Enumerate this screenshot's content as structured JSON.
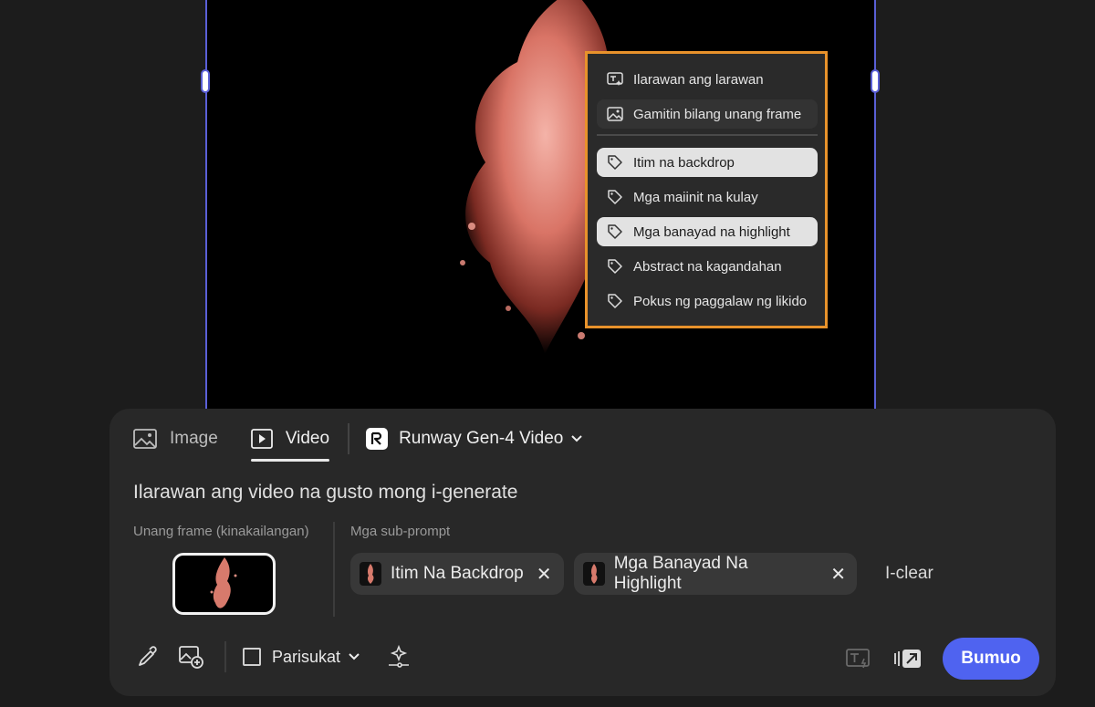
{
  "context_menu": {
    "actions": [
      {
        "label": "Ilarawan ang larawan",
        "icon": "describe-image-icon"
      },
      {
        "label": "Gamitin bilang unang frame",
        "icon": "image-icon"
      }
    ],
    "tags": [
      {
        "label": "Itim na backdrop",
        "icon": "tag-icon"
      },
      {
        "label": "Mga maiinit na kulay",
        "icon": "tag-icon"
      },
      {
        "label": "Mga banayad na highlight",
        "icon": "tag-icon"
      },
      {
        "label": "Abstract na kagandahan",
        "icon": "tag-icon"
      },
      {
        "label": "Pokus ng paggalaw ng likido",
        "icon": "tag-icon"
      }
    ]
  },
  "panel": {
    "tabs": [
      {
        "label": "Image",
        "icon": "image-icon",
        "active": false
      },
      {
        "label": "Video",
        "icon": "video-play-icon",
        "active": true
      }
    ],
    "model": {
      "label": "Runway Gen-4 Video",
      "icon": "runway-logo-icon"
    },
    "prompt_placeholder": "Ilarawan ang video na gusto mong i-generate",
    "first_frame_label": "Unang frame (kinakailangan)",
    "subprompts_label": "Mga sub-prompt",
    "chips": [
      {
        "label": "Itim Na Backdrop"
      },
      {
        "label": "Mga Banayad Na Highlight"
      }
    ],
    "clear_label": "I-clear",
    "aspect_label": "Parisukat",
    "generate_label": "Bumuo"
  },
  "colors": {
    "accent": "#4f63f0",
    "menu_border": "#e8922b",
    "frame_border": "#5a5fd6"
  }
}
